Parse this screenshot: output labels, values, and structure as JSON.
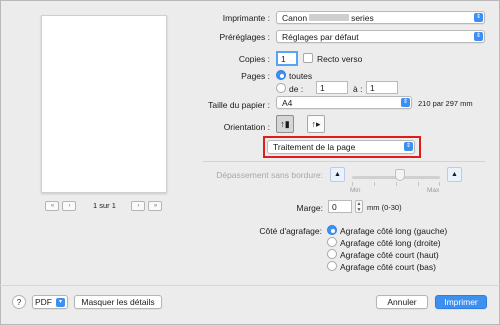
{
  "preview": {
    "page_counter": "1 sur 1",
    "nav_first": "«",
    "nav_prev": "‹",
    "nav_next": "›",
    "nav_last": "»"
  },
  "printer": {
    "label": "Imprimante :",
    "value_prefix": "Canon",
    "value_suffix": "series"
  },
  "presets": {
    "label": "Préréglages :",
    "value": "Réglages par défaut"
  },
  "copies": {
    "label": "Copies :",
    "value": "1",
    "duplex_label": "Recto verso"
  },
  "pages": {
    "label": "Pages :",
    "all_label": "toutes",
    "from_label": "de :",
    "from_value": "1",
    "to_label": "à :",
    "to_value": "1"
  },
  "paper_size": {
    "label": "Taille du papier :",
    "value": "A4",
    "dimensions": "210 par 297 mm"
  },
  "orientation": {
    "label": "Orientation :"
  },
  "section_popup": {
    "value": "Traitement de la page"
  },
  "borderless": {
    "label": "Dépassement sans bordure:",
    "min": "Min",
    "max": "Max",
    "level": 0.55
  },
  "margin": {
    "label": "Marge:",
    "value": "0",
    "unit_range": "mm (0-30)"
  },
  "staple": {
    "label": "Côté d'agrafage:",
    "options": [
      "Agrafage côté long (gauche)",
      "Agrafage côté long (droite)",
      "Agrafage côté court (haut)",
      "Agrafage côté court (bas)"
    ],
    "selected_index": 0
  },
  "footer": {
    "help": "?",
    "pdf_label": "PDF",
    "hide_details": "Masquer les détails",
    "cancel": "Annuler",
    "print": "Imprimer"
  },
  "colors": {
    "accent": "#3d8ff0",
    "highlight_border": "#e01d1d"
  }
}
